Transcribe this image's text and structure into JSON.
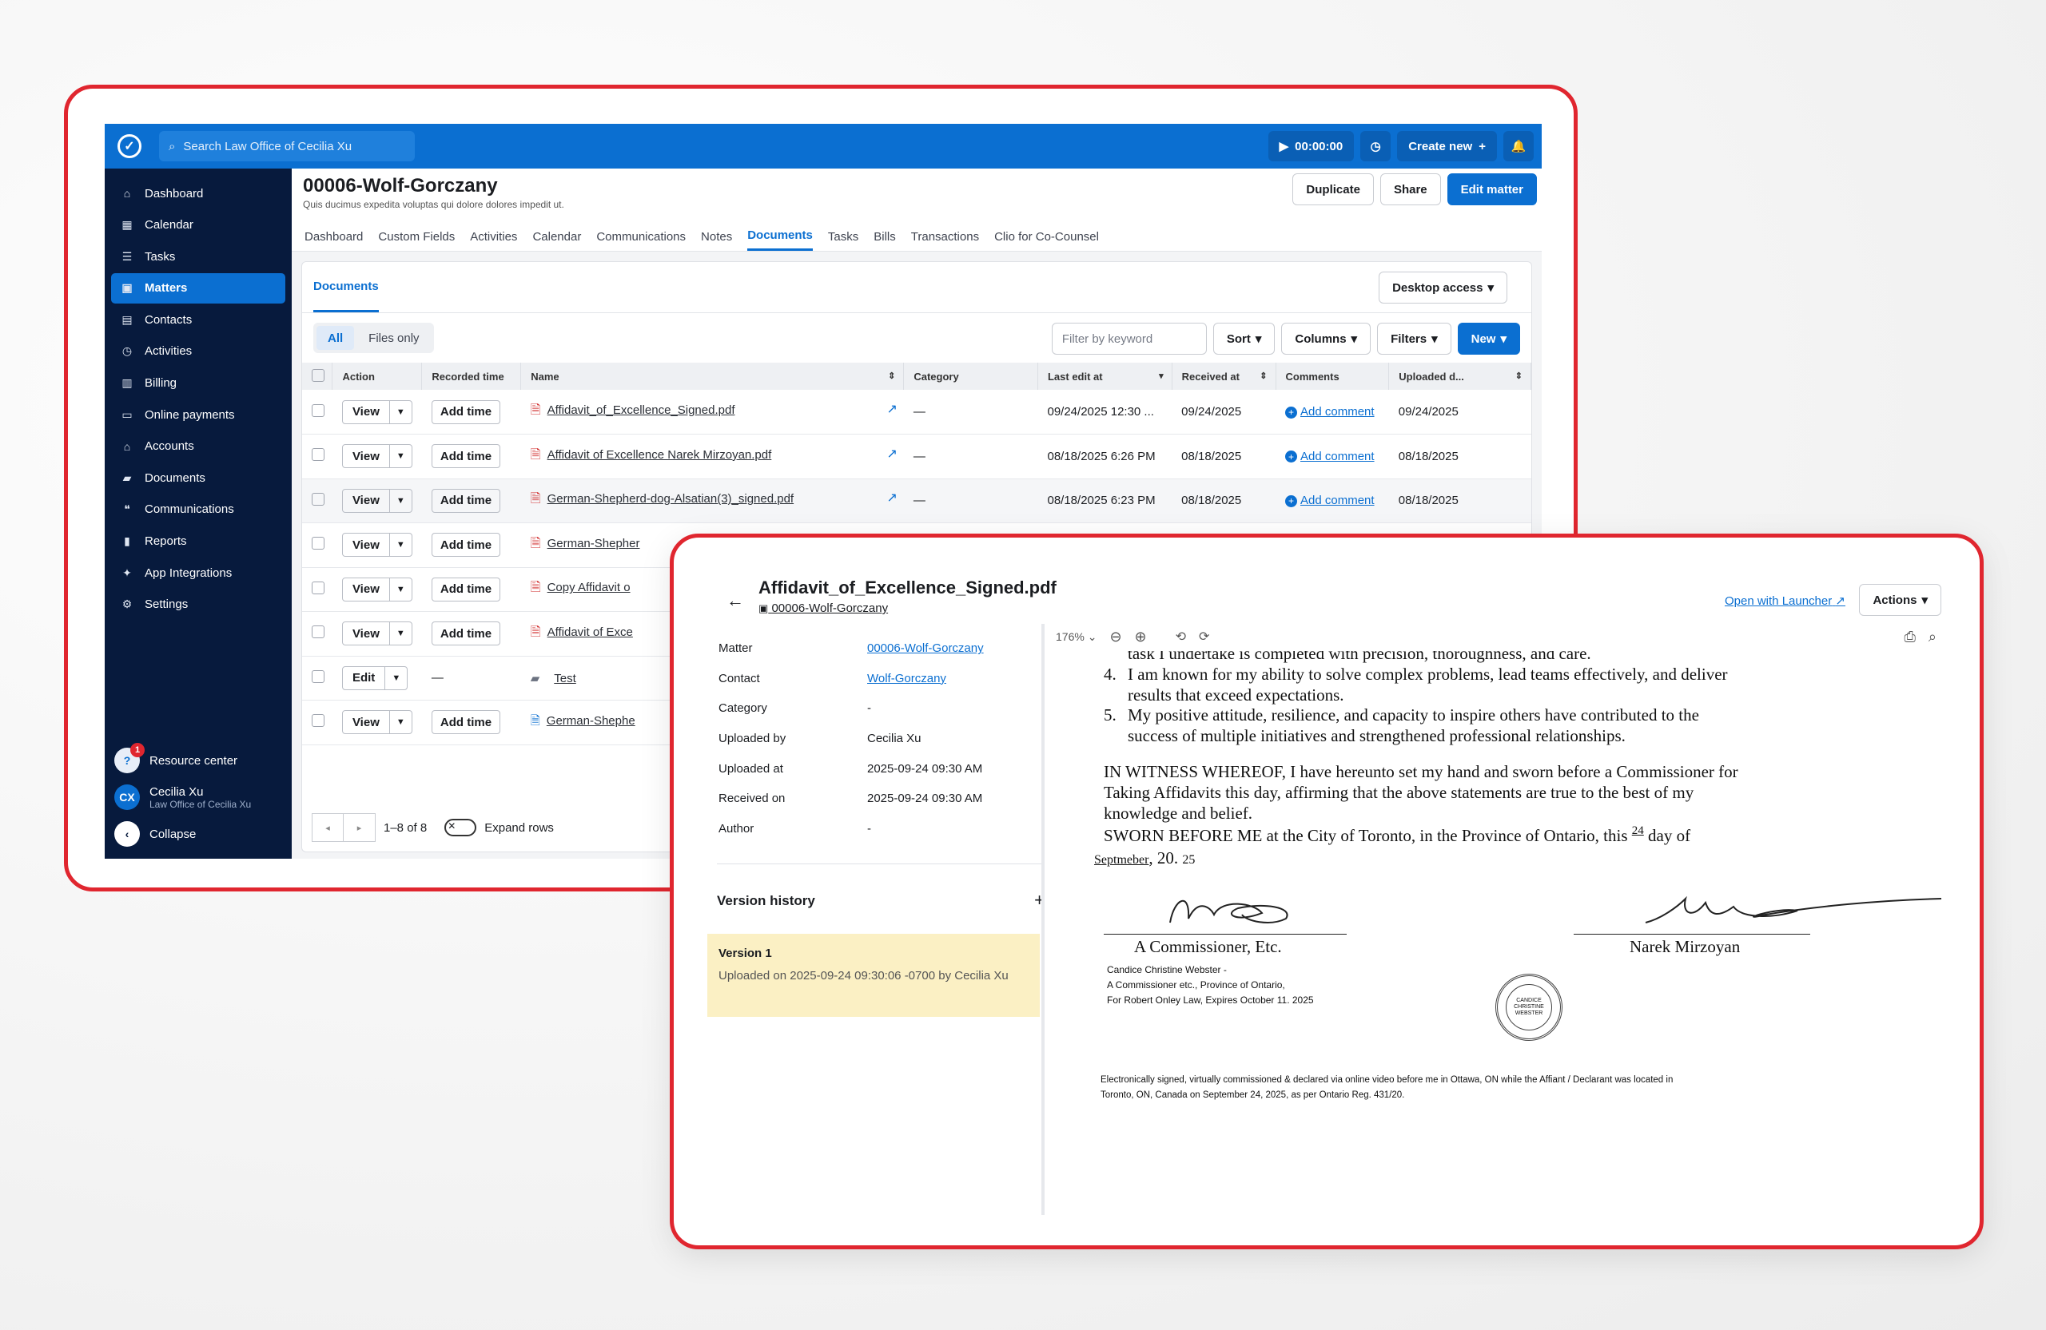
{
  "topbar": {
    "search_placeholder": "Search Law Office of Cecilia Xu",
    "timer": "00:00:00",
    "create_new": "Create new"
  },
  "sidebar": {
    "items": [
      {
        "label": "Dashboard",
        "icon": "home-icon"
      },
      {
        "label": "Calendar",
        "icon": "calendar-icon"
      },
      {
        "label": "Tasks",
        "icon": "tasks-icon"
      },
      {
        "label": "Matters",
        "icon": "briefcase-icon"
      },
      {
        "label": "Contacts",
        "icon": "contacts-icon"
      },
      {
        "label": "Activities",
        "icon": "clock-icon"
      },
      {
        "label": "Billing",
        "icon": "billing-icon"
      },
      {
        "label": "Online payments",
        "icon": "card-icon"
      },
      {
        "label": "Accounts",
        "icon": "bank-icon"
      },
      {
        "label": "Documents",
        "icon": "folder-icon"
      },
      {
        "label": "Communications",
        "icon": "chat-icon"
      },
      {
        "label": "Reports",
        "icon": "chart-icon"
      },
      {
        "label": "App Integrations",
        "icon": "integrations-icon"
      },
      {
        "label": "Settings",
        "icon": "gear-icon"
      }
    ],
    "resource_center": "Resource center",
    "resource_badge": "1",
    "user_initials": "CX",
    "user_name": "Cecilia Xu",
    "user_firm": "Law Office of Cecilia Xu",
    "collapse": "Collapse"
  },
  "matter": {
    "title": "00006-Wolf-Gorczany",
    "subtitle": "Quis ducimus expedita voluptas qui dolore dolores impedit ut.",
    "buttons": {
      "duplicate": "Duplicate",
      "share": "Share",
      "edit": "Edit matter"
    },
    "tabs": [
      "Dashboard",
      "Custom Fields",
      "Activities",
      "Calendar",
      "Communications",
      "Notes",
      "Documents",
      "Tasks",
      "Bills",
      "Transactions",
      "Clio for Co-Counsel"
    ]
  },
  "documents": {
    "tab": "Documents",
    "desktop_access": "Desktop access",
    "seg_all": "All",
    "seg_files": "Files only",
    "filter_placeholder": "Filter by keyword",
    "sort": "Sort",
    "columns": "Columns",
    "filters": "Filters",
    "new": "New",
    "headers": [
      "Action",
      "Recorded time",
      "Name",
      "Category",
      "Last edit at",
      "Received at",
      "Comments",
      "Uploaded d..."
    ],
    "rows": [
      {
        "action": "View",
        "time": "Add time",
        "name": "Affidavit_of_Excellence_Signed.pdf",
        "type": "pdf",
        "category": "—",
        "last_edit": "09/24/2025 12:30 ...",
        "received": "09/24/2025",
        "comment": "Add comment",
        "uploaded": "09/24/2025"
      },
      {
        "action": "View",
        "time": "Add time",
        "name": "Affidavit of Excellence Narek Mirzoyan.pdf",
        "type": "pdf",
        "category": "—",
        "last_edit": "08/18/2025 6:26 PM",
        "received": "08/18/2025",
        "comment": "Add comment",
        "uploaded": "08/18/2025"
      },
      {
        "action": "View",
        "time": "Add time",
        "name": "German-Shepherd-dog-Alsatian(3)_signed.pdf",
        "type": "pdf",
        "category": "—",
        "last_edit": "08/18/2025 6:23 PM",
        "received": "08/18/2025",
        "comment": "Add comment",
        "uploaded": "08/18/2025"
      },
      {
        "action": "View",
        "time": "Add time",
        "name": "German-Shepher",
        "type": "pdf"
      },
      {
        "action": "View",
        "time": "Add time",
        "name": "Copy Affidavit o",
        "type": "pdf"
      },
      {
        "action": "View",
        "time": "Add time",
        "name": "Affidavit of Exce",
        "type": "pdf"
      },
      {
        "action": "Edit",
        "time": "—",
        "name": "Test",
        "type": "folder"
      },
      {
        "action": "View",
        "time": "Add time",
        "name": "German-Shephe",
        "type": "doc"
      }
    ],
    "pager": "1–8 of 8",
    "expand_rows": "Expand rows"
  },
  "viewer": {
    "title": "Affidavit_of_Excellence_Signed.pdf",
    "matter_link": "00006-Wolf-Gorczany",
    "open_launcher": "Open with Launcher",
    "actions": "Actions",
    "meta": [
      {
        "k": "Matter",
        "v": "00006-Wolf-Gorczany",
        "link": true
      },
      {
        "k": "Contact",
        "v": "Wolf-Gorczany",
        "link": true
      },
      {
        "k": "Category",
        "v": "-"
      },
      {
        "k": "Uploaded by",
        "v": "Cecilia Xu"
      },
      {
        "k": "Uploaded at",
        "v": "2025-09-24 09:30 AM"
      },
      {
        "k": "Received on",
        "v": "2025-09-24 09:30 AM"
      },
      {
        "k": "Author",
        "v": "-"
      }
    ],
    "version_history": "Version history",
    "version_title": "Version 1",
    "version_sub": "Uploaded on 2025-09-24 09:30:06 -0700 by Cecilia Xu",
    "zoom": "176%"
  },
  "pdf": {
    "line0": "task I undertake is completed with precision, thoroughness, and care.",
    "item4a": "I am known for my ability to solve complex problems, lead teams effectively, and deliver",
    "item4b": "results that exceed expectations.",
    "item5a": "My positive attitude, resilience, and capacity to inspire others have contributed to the",
    "item5b": "success of multiple initiatives and strengthened professional relationships.",
    "witness1": "IN WITNESS WHEREOF, I have hereunto set my hand and sworn before a Commissioner for",
    "witness2": "Taking Affidavits this day, affirming that the above statements are true to the best of my",
    "witness3": "knowledge and belief.",
    "sworn": "SWORN BEFORE ME at the City of Toronto, in the Province of Ontario, this",
    "day": "24",
    "day_of": "day of",
    "month": "Septmeber",
    "year_prefix": ", 20.",
    "year": "25",
    "commissioner": "A Commissioner, Etc.",
    "deponent": "Narek Mirzoyan",
    "comm1": "Candice Christine Webster -",
    "comm2": "A Commissioner etc., Province of Ontario,",
    "comm3": "For Robert Onley Law, Expires October 11. 2025",
    "seal_text": "CANDICE CHRISTINE WEBSTER",
    "footer1": "Electronically signed, virtually commissioned & declared via online video before me in Ottawa, ON while the Affiant / Declarant was located in",
    "footer2": "Toronto, ON, Canada on September 24, 2025, as per Ontario Reg. 431/20."
  }
}
